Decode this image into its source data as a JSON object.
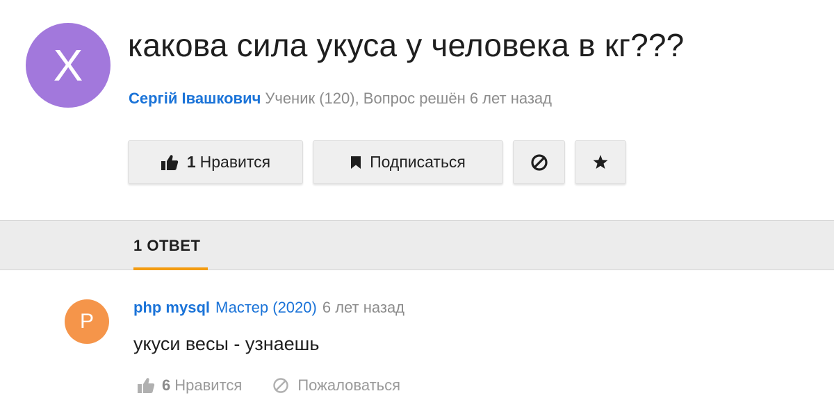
{
  "colors": {
    "question_avatar_bg": "#a278dc",
    "answer_avatar_bg": "#f5954a",
    "link_blue": "#1a73d8",
    "tab_underline": "#f39c12"
  },
  "question": {
    "avatar_letter": "X",
    "title": "какова сила укуса у человека в кг???",
    "author": "Сергій Івашкович",
    "meta": "Ученик (120), Вопрос решён 6 лет назад",
    "actions": {
      "like_count": "1",
      "like_label": "Нравится",
      "like_icon": "thumbs-up-icon",
      "subscribe_label": "Подписаться",
      "subscribe_icon": "bookmark-icon",
      "block_icon": "ban-icon",
      "favorite_icon": "star-icon"
    }
  },
  "answers": {
    "tab_label": "1 ОТВЕТ",
    "items": [
      {
        "avatar_letter": "P",
        "author": "php mysql",
        "rank": "Мастер (2020)",
        "time": "6 лет назад",
        "text": "укуси весы - узнаешь",
        "like_count": "6",
        "like_label": "Нравится",
        "report_label": "Пожаловаться"
      }
    ]
  }
}
